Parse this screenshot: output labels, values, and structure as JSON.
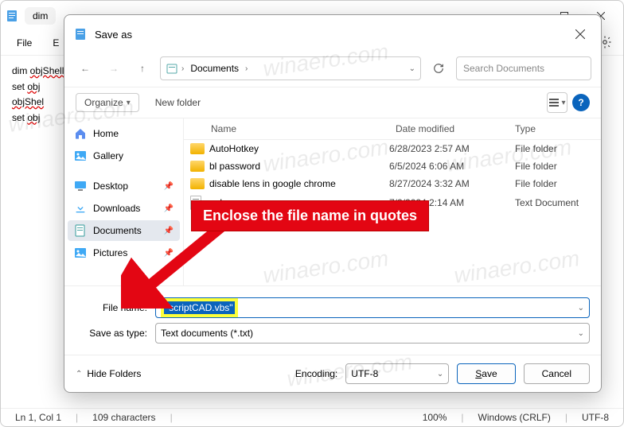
{
  "notepad": {
    "tab_title": "dim",
    "menu": {
      "file": "File",
      "edit": "E",
      "settings_icon": "gear"
    },
    "content_lines": [
      {
        "pre": "dim ",
        "red": "objShell"
      },
      {
        "pre": "set ",
        "red": "obj"
      },
      {
        "pre": "",
        "red": "objShel"
      },
      {
        "pre": "set ",
        "red": "obj"
      }
    ],
    "status": {
      "pos": "Ln 1, Col 1",
      "chars": "109 characters",
      "zoom": "100%",
      "eol": "Windows (CRLF)",
      "enc": "UTF-8"
    }
  },
  "dialog": {
    "title": "Save as",
    "breadcrumb": {
      "root": "",
      "folder": "Documents"
    },
    "search_placeholder": "Search Documents",
    "toolbar": {
      "organize": "Organize",
      "newfolder": "New folder"
    },
    "sidebar": [
      {
        "icon": "home",
        "label": "Home"
      },
      {
        "icon": "gallery",
        "label": "Gallery"
      },
      {
        "sep": true
      },
      {
        "icon": "desktop",
        "label": "Desktop",
        "pin": true
      },
      {
        "icon": "downloads",
        "label": "Downloads",
        "pin": true
      },
      {
        "icon": "documents",
        "label": "Documents",
        "pin": true,
        "selected": true
      },
      {
        "icon": "pictures",
        "label": "Pictures",
        "pin": true
      }
    ],
    "columns": {
      "name": "Name",
      "date": "Date modified",
      "type": "Type"
    },
    "files": [
      {
        "icon": "folder",
        "name": "AutoHotkey",
        "date": "6/28/2023 2:57 AM",
        "type": "File folder"
      },
      {
        "icon": "folder",
        "name": "bl password",
        "date": "6/5/2024 6:06 AM",
        "type": "File folder"
      },
      {
        "icon": "folder",
        "name": "disable lens in google chrome",
        "date": "8/27/2024 3:32 AM",
        "type": "File folder"
      },
      {
        "icon": "txt",
        "name": "undo",
        "date": "7/2/2024 2:14 AM",
        "type": "Text Document"
      }
    ],
    "fields": {
      "filename_label": "File name:",
      "filename_value": "\"scriptCAD.vbs\"",
      "saveas_label": "Save as type:",
      "saveas_value": "Text documents (*.txt)"
    },
    "buttons": {
      "hide": "Hide Folders",
      "encoding_label": "Encoding:",
      "encoding_value": "UTF-8",
      "save": "Save",
      "cancel": "Cancel"
    }
  },
  "callout": "Enclose the file name in quotes",
  "watermark": "winaero.com"
}
